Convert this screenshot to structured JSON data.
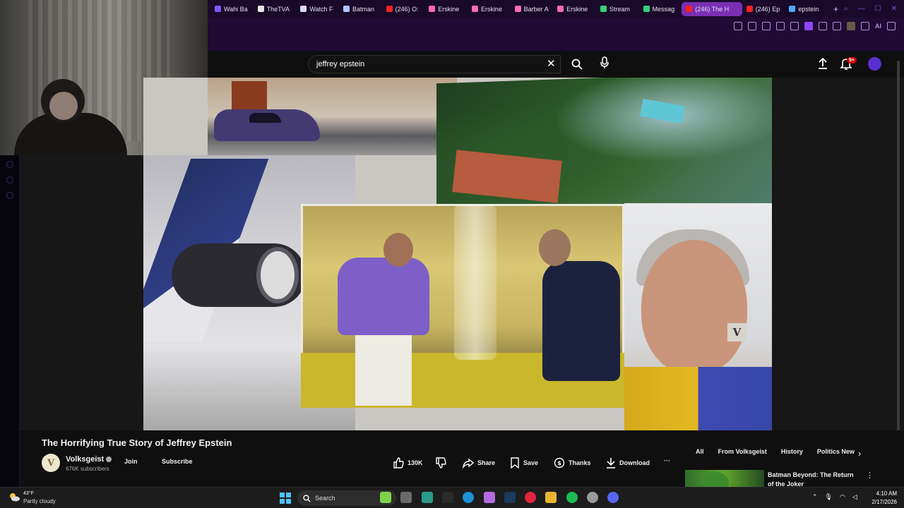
{
  "browser": {
    "tabs": [
      {
        "label": "Wahi Ba",
        "color": "#7a5cff"
      },
      {
        "label": "TheTVA",
        "color": "#e6e6e6"
      },
      {
        "label": "Watch F",
        "color": "#d9d9ff"
      },
      {
        "label": "Batman",
        "color": "#b0c4ff"
      },
      {
        "label": "(246) O:",
        "color": "#ff2020"
      },
      {
        "label": "Erskine",
        "color": "#ff6ab0"
      },
      {
        "label": "Erskine",
        "color": "#ff6ab0"
      },
      {
        "label": "Barber A",
        "color": "#ff6ab0"
      },
      {
        "label": "Erskine",
        "color": "#ff6ab0"
      },
      {
        "label": "Stream",
        "color": "#33d17a"
      },
      {
        "label": "Messag",
        "color": "#33d17a"
      },
      {
        "label": "(246) The H",
        "color": "#ff2020",
        "active": true
      },
      {
        "label": "(246) Ep",
        "color": "#ff2020"
      },
      {
        "label": "epstein",
        "color": "#4ea8ff"
      }
    ],
    "new_tab": "+",
    "ai_label": "AI"
  },
  "masthead": {
    "search_value": "jeffrey epstein",
    "notification_badge": "9+"
  },
  "video": {
    "title": "The Horrifying True Story of Jeffrey Epstein",
    "watermark": "V"
  },
  "channel": {
    "avatar_letter": "V",
    "name": "Volksgeist",
    "subscribers": "676K subscribers",
    "join_label": "Join",
    "subscribe_label": "Subscribe"
  },
  "actions": {
    "likes": "130K",
    "share": "Share",
    "save": "Save",
    "thanks": "Thanks",
    "download": "Download",
    "more": "···"
  },
  "chips": [
    "All",
    "From Volksgeist",
    "History",
    "Politics New"
  ],
  "recommendation": {
    "title": "Batman Beyond: The Return of the Joker",
    "more": "⋮"
  },
  "taskbar": {
    "temperature": "43°F",
    "weather": "Partly cloudy",
    "search_label": "Search",
    "time": "4:10 AM",
    "date": "2/17/2026",
    "apps": [
      {
        "name": "mask-app",
        "color": "#7fd14b"
      },
      {
        "name": "file-explorer",
        "color": "#6a6a6a"
      },
      {
        "name": "teams",
        "color": "#2b9a8a"
      },
      {
        "name": "epic-games",
        "color": "#2a2a2a"
      },
      {
        "name": "edge",
        "color": "#1c8fd8"
      },
      {
        "name": "copilot",
        "color": "#b36be0"
      },
      {
        "name": "steam",
        "color": "#1b3a5c"
      },
      {
        "name": "opera-gx",
        "color": "#e0243c"
      },
      {
        "name": "folder",
        "color": "#e7b631"
      },
      {
        "name": "spotify",
        "color": "#1db954"
      },
      {
        "name": "chrome",
        "color": "#9a9a9a"
      },
      {
        "name": "discord",
        "color": "#5865f2"
      }
    ]
  }
}
